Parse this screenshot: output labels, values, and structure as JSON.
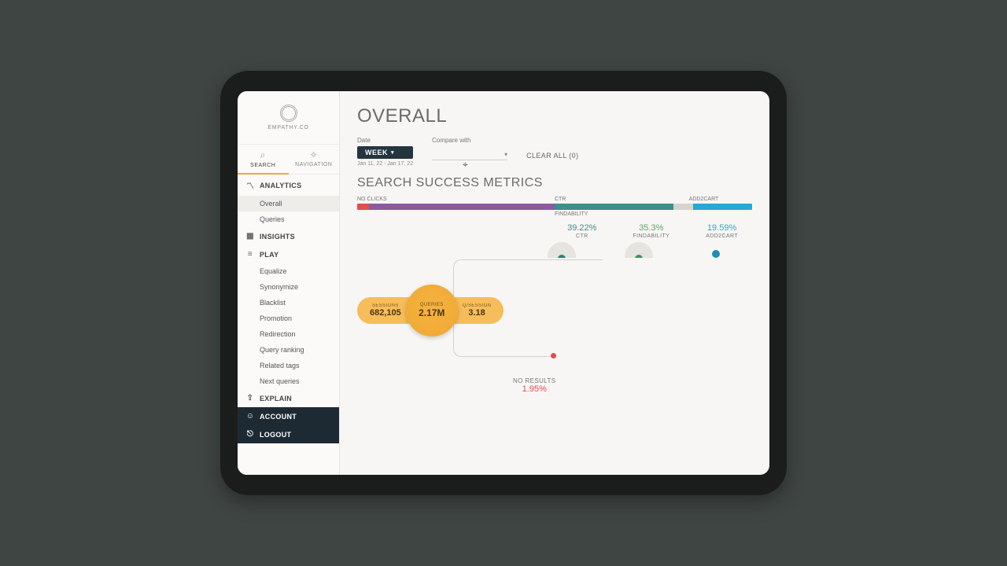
{
  "brand": {
    "name": "EMPATHY.CO"
  },
  "topTabs": {
    "search": "SEARCH",
    "navigation": "NAVIGATION"
  },
  "sidebar": {
    "sections": {
      "analytics": "ANALYTICS",
      "insights": "INSIGHTS",
      "play": "PLAY",
      "explain": "EXPLAIN",
      "account": "ACCOUNT",
      "logout": "LOGOUT"
    },
    "analytics_items": [
      "Overall",
      "Queries"
    ],
    "play_items": [
      "Equalize",
      "Synonymize",
      "Blacklist",
      "Promotion",
      "Redirection",
      "Query ranking",
      "Related tags",
      "Next queries"
    ]
  },
  "page": {
    "title": "OVERALL",
    "filters": {
      "date_label": "Date",
      "date_value": "WEEK",
      "date_range": "Jan 11, 22 - Jan 17, 22",
      "compare_label": "Compare with",
      "clear": "CLEAR ALL (0)"
    },
    "section_title": "SEARCH SUCCESS METRICS",
    "barLegend": {
      "noclicks": "NO CLICKS",
      "ctr": "CTR",
      "add2cart": "ADD2CART",
      "findability": "FINDABILITY"
    },
    "kpis": {
      "ctr": {
        "label": "CTR",
        "value": "39.22%"
      },
      "findability": {
        "label": "FINDABILITY",
        "value": "35.3%"
      },
      "add2cart": {
        "label": "ADD2CART",
        "value": "19.59%"
      }
    },
    "flow": {
      "sessions": {
        "label": "SESSIONS",
        "value": "682,105"
      },
      "queries": {
        "label": "QUERIES",
        "value": "2.17M"
      },
      "qsession": {
        "label": "Q/SESSION",
        "value": "3.18"
      }
    },
    "no_results": {
      "label": "NO RESULTS",
      "value": "1.95%"
    }
  },
  "chart_data": {
    "type": "bar",
    "title": "Search Success Metrics — session breakdown",
    "series": [
      {
        "name": "NO CLICKS",
        "pct": 50
      },
      {
        "name": "CTR",
        "pct": 30
      },
      {
        "name": "FINDABILITY",
        "pct": 5
      },
      {
        "name": "ADD2CART",
        "pct": 15
      }
    ],
    "kpis": {
      "CTR": 39.22,
      "FINDABILITY": 35.3,
      "ADD2CART": 19.59,
      "NO_RESULTS": 1.95
    },
    "totals": {
      "sessions": 682105,
      "queries": 2170000,
      "queries_per_session": 3.18
    }
  }
}
